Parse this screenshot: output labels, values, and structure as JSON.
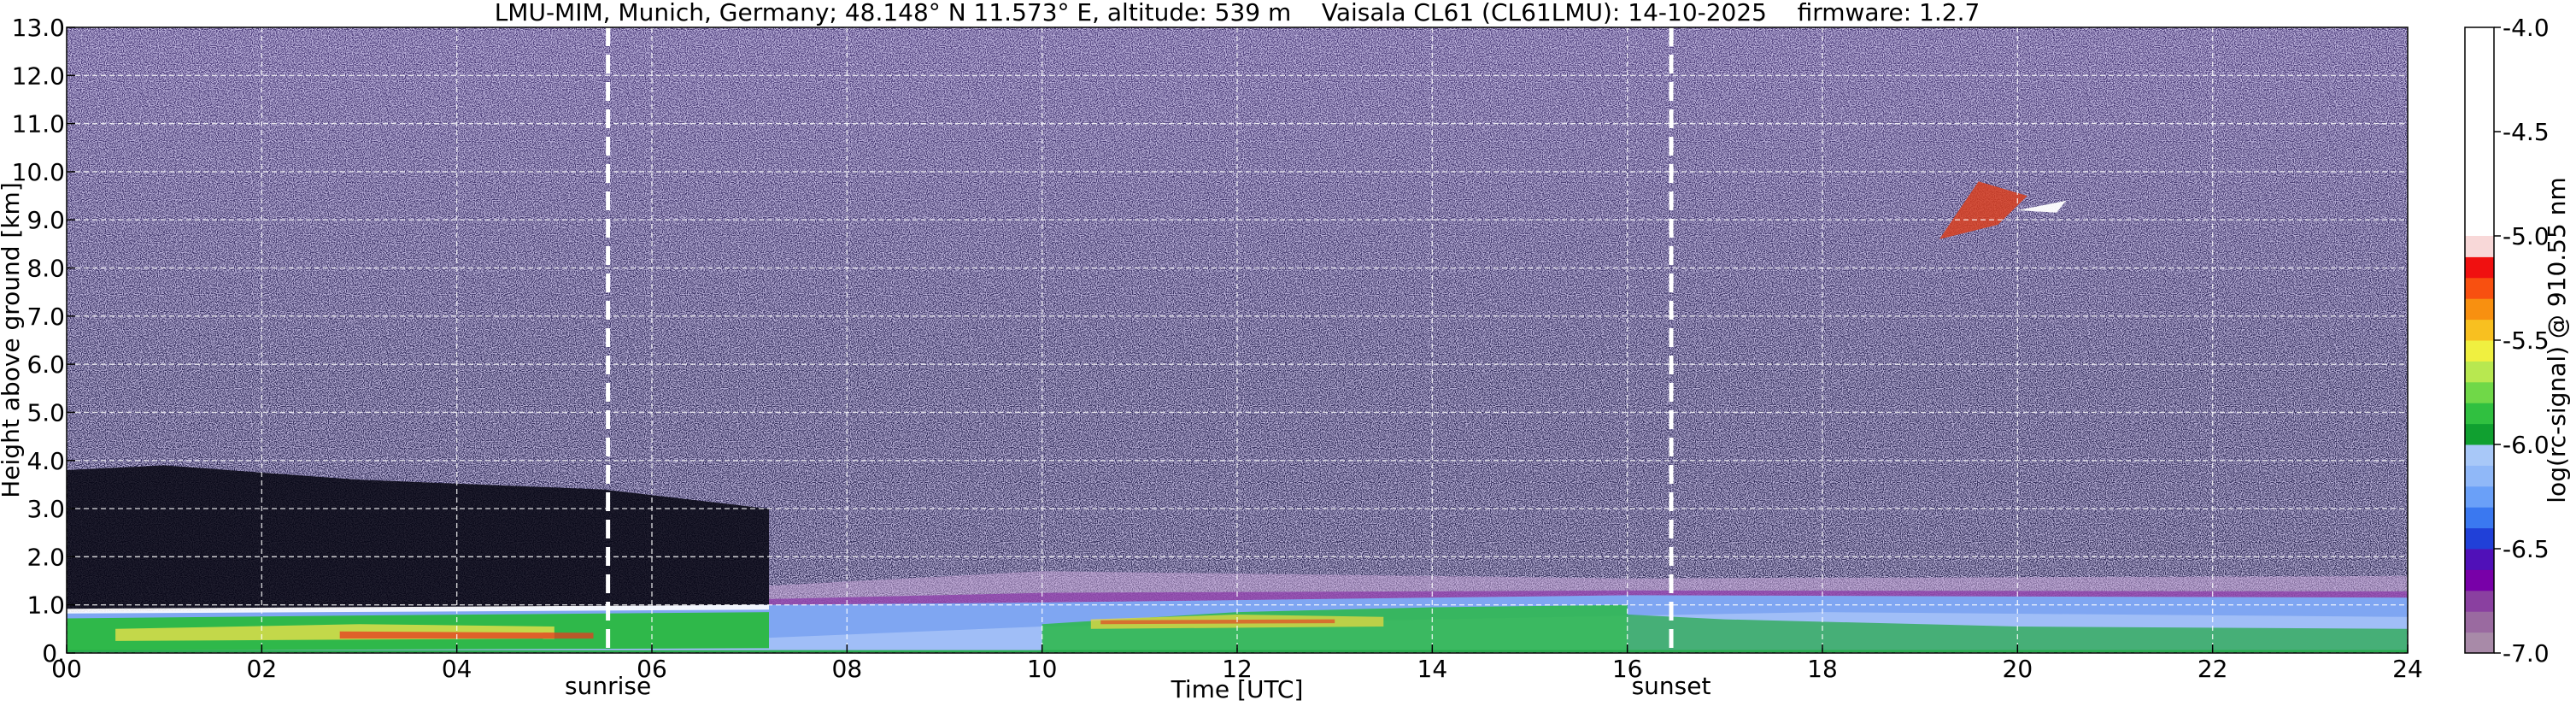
{
  "chart_data": {
    "type": "heatmap",
    "title": "LMU-MIM, Munich, Germany; 48.148° N 11.573° E, altitude: 539 m    Vaisala CL61 (CL61LMU): 14-10-2025    firmware: 1.2.7",
    "xlabel": "Time [UTC]",
    "ylabel": "Height above ground [km]",
    "colorbar_label": "log(rc-signal) @ 910.55 nm",
    "x_ticks": [
      "00",
      "02",
      "04",
      "06",
      "08",
      "10",
      "12",
      "14",
      "16",
      "18",
      "20",
      "22",
      "24"
    ],
    "y_ticks": [
      "0.",
      "1.0",
      "2.0",
      "3.0",
      "4.0",
      "5.0",
      "6.0",
      "7.0",
      "8.0",
      "9.0",
      "10.0",
      "11.0",
      "12.0",
      "13.0"
    ],
    "colorbar_ticks": [
      "-4.0",
      "-4.5",
      "-5.0",
      "-5.5",
      "-6.0",
      "-6.5",
      "-7.0"
    ],
    "xlim": [
      0,
      24
    ],
    "ylim": [
      0,
      13
    ],
    "clim": [
      -7.0,
      -4.0
    ],
    "grid": true,
    "colormap": [
      "#a88aa8",
      "#9a6aa0",
      "#8a40a0",
      "#7800a8",
      "#5010b8",
      "#2040d8",
      "#3a78f0",
      "#6aa0f8",
      "#90b8f8",
      "#a8c8f8",
      "#10a030",
      "#30c040",
      "#70d848",
      "#b8e850",
      "#f0f040",
      "#f8c020",
      "#f89010",
      "#f85010",
      "#f01010",
      "#f8d8d8",
      "#ffffff"
    ],
    "annotations": [
      {
        "text": "sunrise",
        "x": 5.55
      },
      {
        "text": "sunset",
        "x": 16.45
      }
    ]
  }
}
